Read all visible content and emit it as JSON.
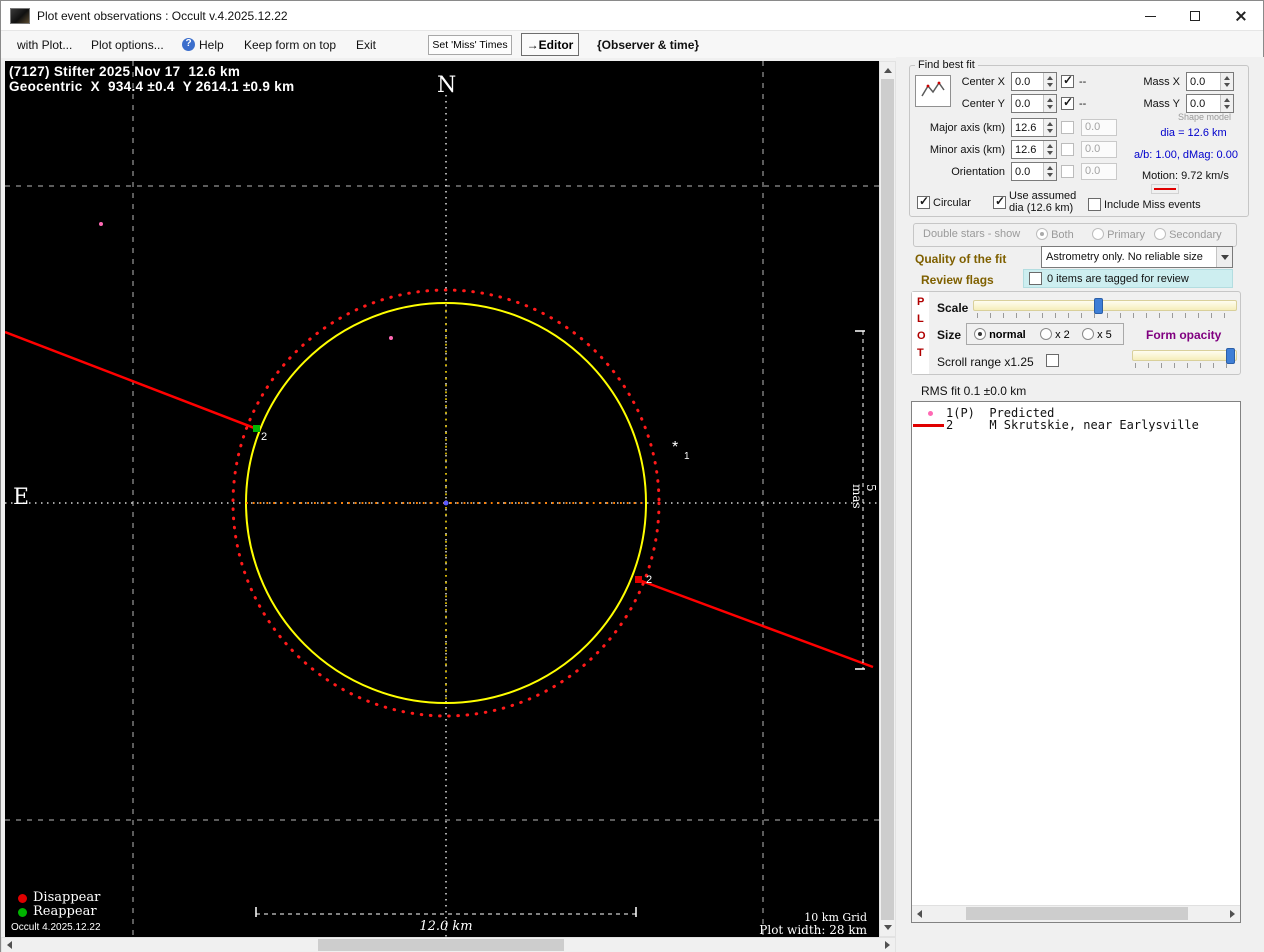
{
  "colors": {
    "profile_circle": "#ffff00",
    "fit_circle_dotted": "#ff1a1a",
    "chord": "#ff0000",
    "reappear_marker": "#00b400",
    "disappear_marker": "#e00000",
    "predicted_dot": "#ff69b4",
    "info_blue_text": "#0000cc",
    "section_label": "#7f6000",
    "form_opacity_label": "#800080",
    "plot_letters": "#b00000",
    "slider_thumb": "#3f7fd6",
    "review_box_bg": "#cdeef0"
  },
  "window": {
    "title": "Plot event observations : Occult v.4.2025.12.22"
  },
  "menubar": {
    "with_plot": "with Plot...",
    "plot_options": "Plot options...",
    "help": "Help",
    "keep_on_top": "Keep form on top",
    "exit": "Exit",
    "set_miss_times": "Set 'Miss' Times",
    "editor": "→Editor",
    "observer_time": "{Observer & time}"
  },
  "plot": {
    "header_line1": "(7127) Stifter 2025 Nov 17  12.6 km",
    "header_line2": "Geocentric  X  934.4 ±0.4  Y 2614.1 ±0.9 km",
    "north": "N",
    "east": "E",
    "scale_label": "12.0 km",
    "mas_label": "5 mas",
    "grid_label": "10 km Grid",
    "width_label": "Plot width: 28 km",
    "chord1_label": "2",
    "chord2_label": "2",
    "star_marker": "*",
    "star_label": "1",
    "legend": {
      "disappear": "Disappear",
      "reappear": "Reappear",
      "version": "Occult 4.2025.12.22"
    }
  },
  "fit": {
    "group_title": "Find best fit",
    "center_x_label": "Center X",
    "center_x_value": "0.0",
    "center_x_alt": "--",
    "center_y_label": "Center Y",
    "center_y_value": "0.0",
    "center_y_alt": "--",
    "mass_x_label": "Mass X",
    "mass_x_value": "0.0",
    "mass_y_label": "Mass Y",
    "mass_y_value": "0.0",
    "major_label": "Major axis (km)",
    "major_value": "12.6",
    "major_alt": "0.0",
    "minor_label": "Minor axis (km)",
    "minor_value": "12.6",
    "minor_alt": "0.0",
    "orientation_label": "Orientation",
    "orientation_value": "0.0",
    "orientation_alt": "0.0",
    "shape_model_label": "Shape model",
    "dia_text": "dia = 12.6 km",
    "ab_text": "a/b: 1.00, dMag: 0.00",
    "motion_text": "Motion: 9.72 km/s",
    "circular_label": "Circular",
    "use_assumed_line1": "Use assumed",
    "use_assumed_line2": "dia (12.6 km)",
    "include_miss_label": "Include Miss events"
  },
  "double_stars": {
    "title": "Double stars - show",
    "options": [
      "Both",
      "Primary",
      "Secondary"
    ]
  },
  "quality": {
    "label": "Quality of the fit",
    "value": "Astrometry only. No reliable size"
  },
  "review": {
    "label": "Review flags",
    "checkbox_label": "0 items are tagged for review"
  },
  "plot_controls": {
    "letters": [
      "P",
      "L",
      "O",
      "T"
    ],
    "scale_label": "Scale",
    "size_label": "Size",
    "size_options": [
      "normal",
      "x 2",
      "x 5"
    ],
    "form_opacity_label": "Form opacity",
    "scroll_range_label": "Scroll range x1.25"
  },
  "rms_label": "RMS fit 0.1 ±0.0 km",
  "observations": {
    "rows": [
      {
        "text": "1(P)  Predicted"
      },
      {
        "text": "2     M Skrutskie, near Earlysville"
      }
    ]
  }
}
